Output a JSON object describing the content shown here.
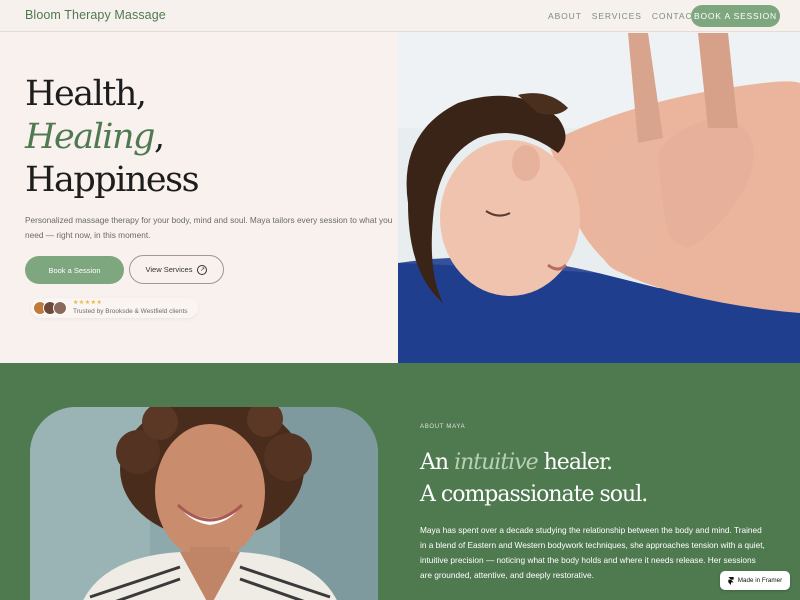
{
  "nav": {
    "brand": "Bloom Therapy Massage",
    "links": [
      "ABOUT",
      "SERVICES",
      "CONTACT"
    ],
    "cta": "BOOK A SESSION"
  },
  "hero": {
    "line1": "Health,",
    "line2": "Healing",
    "line2_suffix": ",",
    "line3": "Happiness",
    "description": "Personalized massage therapy for your body, mind and soul. Maya tailors every session to what you need — right now, in this moment.",
    "primary_button": "Book a Session",
    "secondary_button": "View Services",
    "stars": "★★★★★",
    "trust_text": "Trusted by Brooksde & Westfield clients"
  },
  "about": {
    "eyebrow": "ABOUT MAYA",
    "title_pre": "An ",
    "title_italic": "intuitive",
    "title_post": " healer.",
    "title_line2": "A compassionate soul.",
    "body": "Maya has spent over a decade studying the relationship between the body and mind. Trained in a blend of Eastern and Western bodywork techniques, she approaches tension with a quiet, intuitive precision — noticing what the body holds and where it needs release. Her sessions are grounded, attentive, and deeply restorative."
  },
  "framer_badge": "Made in Framer",
  "colors": {
    "accent": "#4f7a50",
    "button": "#7ea67f",
    "background": "#f7f1ee"
  }
}
